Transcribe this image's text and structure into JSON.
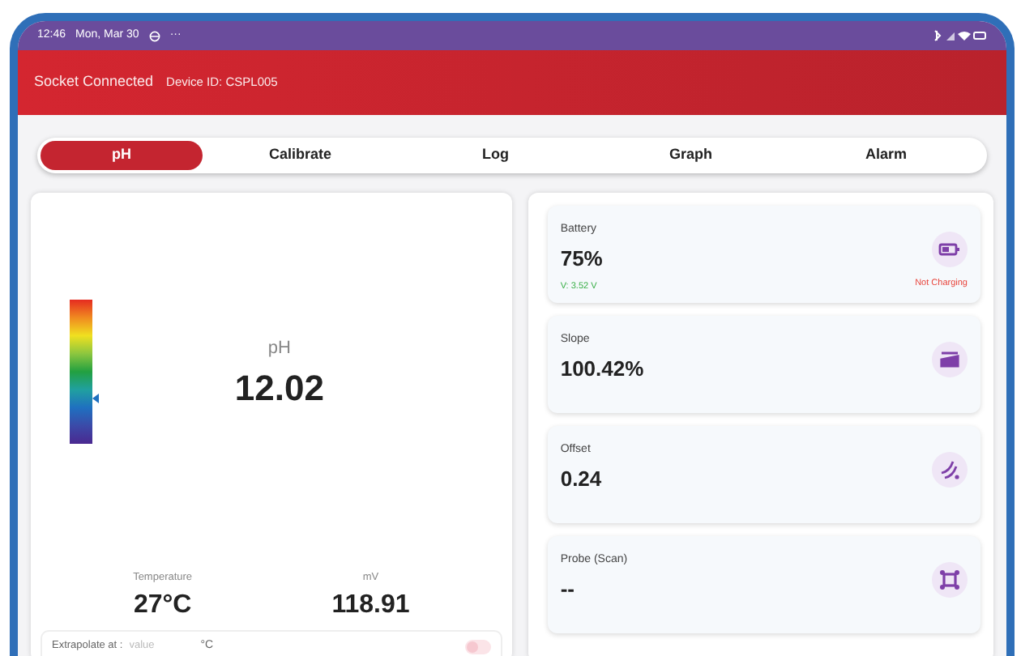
{
  "status_bar": {
    "time": "12:46",
    "date": "Mon, Mar 30",
    "extra": "···"
  },
  "header": {
    "connection": "Socket Connected",
    "device_id": "Device ID: CSPL005"
  },
  "tabs": [
    {
      "label": "pH",
      "selected": true
    },
    {
      "label": "Calibrate",
      "selected": false
    },
    {
      "label": "Log",
      "selected": false
    },
    {
      "label": "Graph",
      "selected": false
    },
    {
      "label": "Alarm",
      "selected": false
    }
  ],
  "reading": {
    "level": 0.31,
    "label": "pH",
    "value": "12.02"
  },
  "secondary": [
    {
      "label": "Temperature",
      "value": "27°C"
    },
    {
      "label": "mV",
      "value": "118.91"
    }
  ],
  "extrapolate": {
    "label": "Extrapolate at :",
    "placeholder": "value",
    "unit": "°C",
    "on": false
  },
  "cards": [
    {
      "kind": "battery",
      "label": "Battery",
      "value": "75%",
      "voltage": "V: 3.52 V",
      "charging_status": "Not Charging"
    },
    {
      "kind": "slope",
      "label": "Slope",
      "value": "100.42%"
    },
    {
      "kind": "offset",
      "label": "Offset",
      "value": "0.24"
    },
    {
      "kind": "probe",
      "label": "Probe (Scan)",
      "value": "--"
    }
  ]
}
